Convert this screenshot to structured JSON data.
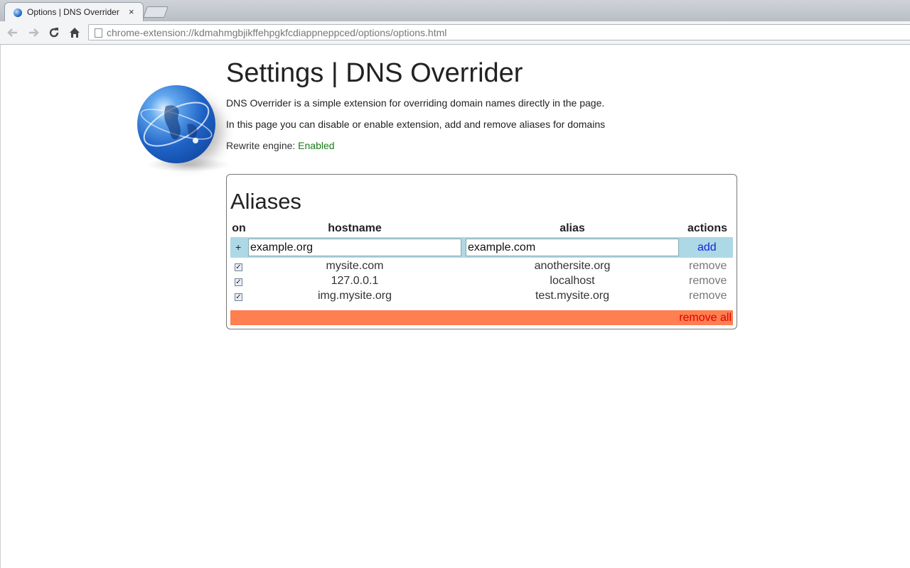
{
  "browser": {
    "tab_title": "Options | DNS Overrider",
    "tab_close": "×",
    "url": "chrome-extension://kdmahmgbjikffehpgkfcdiappneppced/options/options.html"
  },
  "page": {
    "title": "Settings | DNS Overrider",
    "description_1": "DNS Overrider is a simple extension for overriding domain names directly in the page.",
    "description_2": "In this page you can disable or enable extension, add and remove aliases for domains",
    "engine_label": "Rewrite engine: ",
    "engine_status": "Enabled",
    "engine_status_color": "#1a7a1a"
  },
  "aliases": {
    "heading": "Aliases",
    "columns": {
      "on": "on",
      "hostname": "hostname",
      "alias": "alias",
      "actions": "actions"
    },
    "add_row": {
      "plus": "+",
      "hostname_value": "example.org",
      "alias_value": "example.com",
      "add_label": "add",
      "background": "#add8e6"
    },
    "rows": [
      {
        "checked": true,
        "hostname": "mysite.com",
        "alias": "anothersite.org",
        "action": "remove"
      },
      {
        "checked": true,
        "hostname": "127.0.0.1",
        "alias": "localhost",
        "action": "remove"
      },
      {
        "checked": true,
        "hostname": "img.mysite.org",
        "alias": "test.mysite.org",
        "action": "remove"
      }
    ],
    "remove_all_label": "remove all",
    "remove_all_background": "#ff7f50",
    "remove_all_color": "#e00000"
  }
}
